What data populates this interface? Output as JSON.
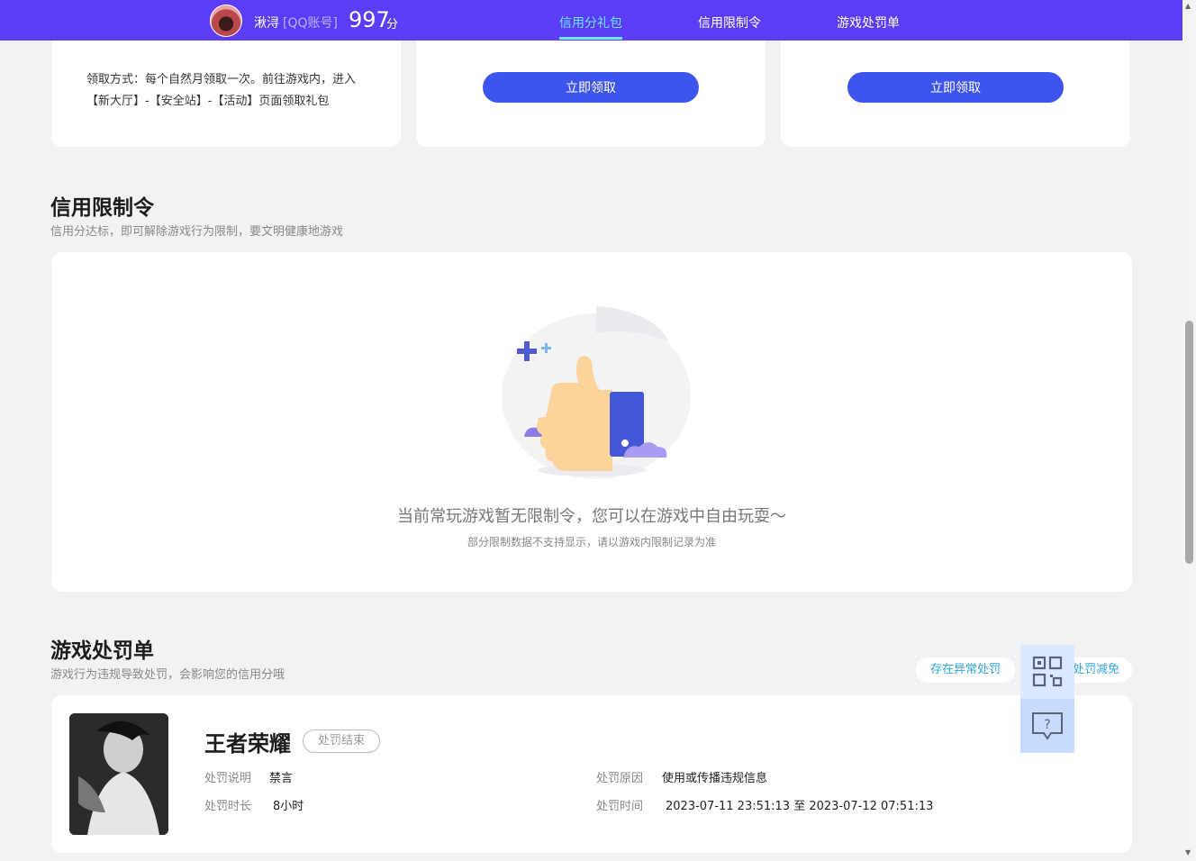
{
  "header": {
    "username": "湫浔",
    "account_tag": "[QQ账号]",
    "score": "997",
    "score_unit": "分",
    "nav": [
      "信用分礼包",
      "信用限制令",
      "游戏处罚单"
    ]
  },
  "gift": {
    "claim_text": "领取方式：每个自然月领取一次。前往游戏内，进入【新大厅】-【安全站】-【活动】页面领取礼包",
    "claim_button": "立即领取"
  },
  "restriction": {
    "title": "信用限制令",
    "subtitle": "信用分达标，即可解除游戏行为限制，要文明健康地游戏",
    "empty_main": "当前常玩游戏暂无限制令，您可以在游戏中自由玩耍～",
    "empty_sub": "部分限制数据不支持显示，请以游戏内限制记录为准"
  },
  "penalty": {
    "title": "游戏处罚单",
    "subtitle": "游戏行为违规导致处罚，会影响您的信用分哦",
    "report_abnormal": "存在异常处罚",
    "reduce": "处罚减免",
    "record": {
      "game": "王者荣耀",
      "status": "处罚结束",
      "desc_label": "处罚说明",
      "desc_value": "禁言",
      "duration_label": "处罚时长",
      "duration_value": "8小时",
      "reason_label": "处罚原因",
      "reason_value": "使用或传播违规信息",
      "time_label": "处罚时间",
      "time_value": "2023-07-11 23:51:13 至 2023-07-12 07:51:13"
    }
  },
  "floating": {
    "help_symbol": "?"
  },
  "colors": {
    "topbar": "#5b3df5",
    "active_nav": "#6ee7ff",
    "primary_button": "#3d55ee",
    "link": "#2fa7e0"
  }
}
